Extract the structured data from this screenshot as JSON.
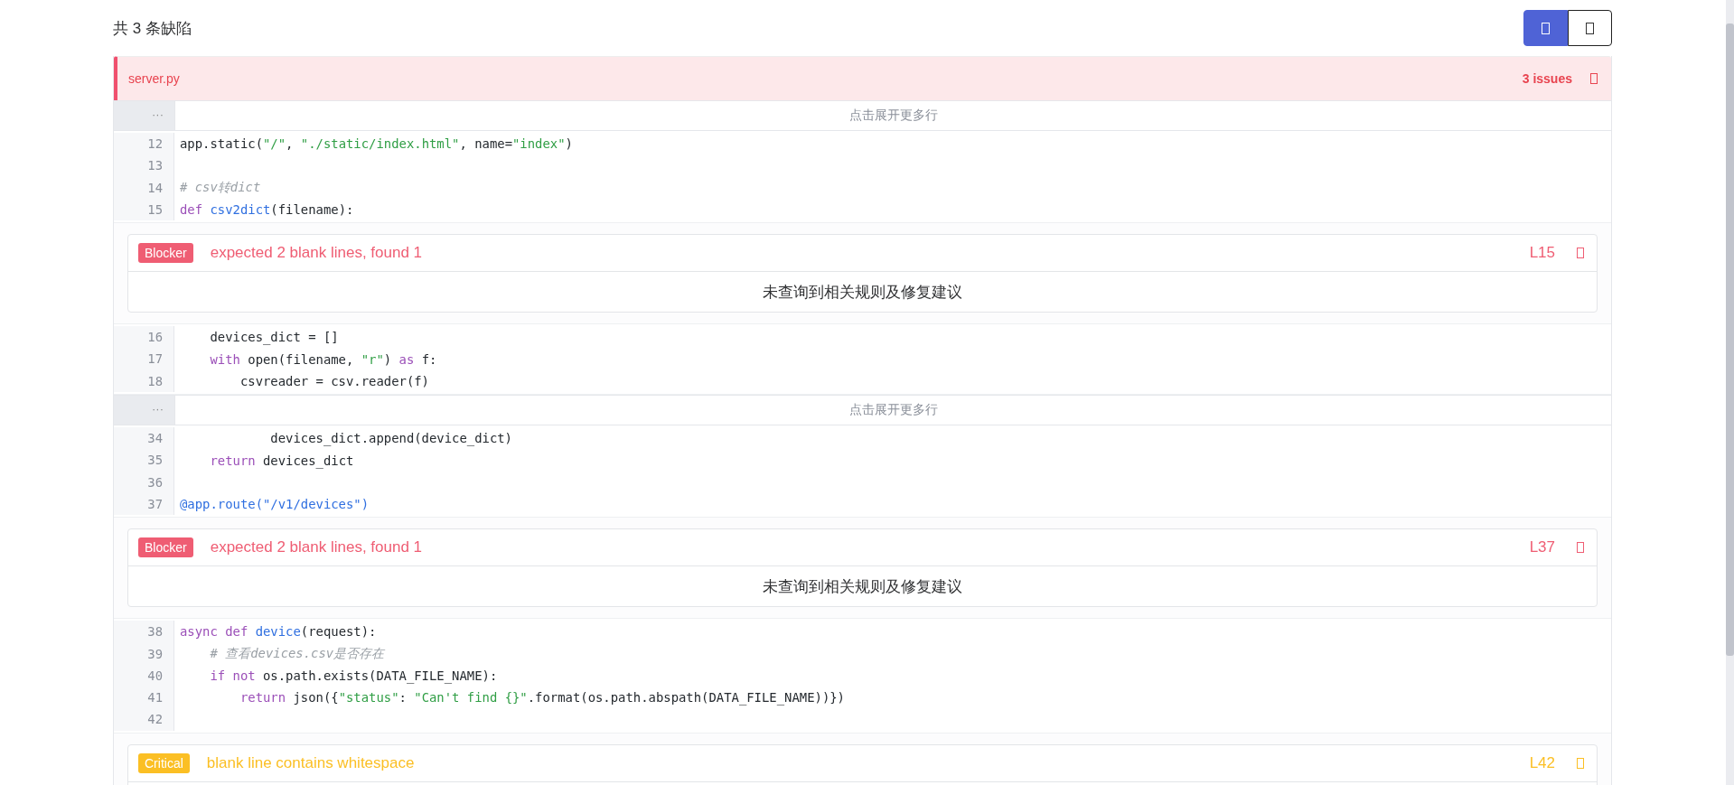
{
  "summary": "共 3 条缺陷",
  "view_toggle": [
    {
      "selected": true
    },
    {
      "selected": false
    }
  ],
  "file": {
    "name": "server.py",
    "issues_label": "3 issues",
    "blocks": [
      {
        "kind": "fold",
        "gutter": "···",
        "label": "点击展开更多行"
      },
      {
        "kind": "code",
        "lines": [
          {
            "no": "12",
            "tokens": [
              {
                "kind": "plain",
                "s": "app.static("
              },
              {
                "kind": "str",
                "s": "\"/\""
              },
              {
                "kind": "plain",
                "s": ", "
              },
              {
                "kind": "str",
                "s": "\"./static/index.html\""
              },
              {
                "kind": "plain",
                "s": ", name="
              },
              {
                "kind": "str",
                "s": "\"index\""
              },
              {
                "kind": "plain",
                "s": ")"
              }
            ]
          },
          {
            "no": "13"
          },
          {
            "no": "14",
            "tokens": [
              {
                "kind": "cmt",
                "s": "# csv转dict"
              }
            ]
          },
          {
            "no": "15",
            "tokens": [
              {
                "kind": "kw",
                "s": "def "
              },
              {
                "kind": "fn",
                "s": "csv2dict"
              },
              {
                "kind": "plain",
                "s": "(filename):"
              }
            ]
          }
        ]
      },
      {
        "kind": "issue",
        "severity": "Blocker",
        "color": "#ef5d73",
        "message": "expected 2 blank lines, found 1",
        "line": "L15",
        "suggestion": "未查询到相关规则及修复建议"
      },
      {
        "kind": "code",
        "lines": [
          {
            "no": "16",
            "tokens": [
              {
                "kind": "plain",
                "s": "    devices_dict = []"
              }
            ]
          },
          {
            "no": "17",
            "tokens": [
              {
                "kind": "kw",
                "s": "    with"
              },
              {
                "kind": "plain",
                "s": " open(filename, "
              },
              {
                "kind": "str",
                "s": "\"r\""
              },
              {
                "kind": "plain",
                "s": ") "
              },
              {
                "kind": "kw",
                "s": "as"
              },
              {
                "kind": "plain",
                "s": " f:"
              }
            ]
          },
          {
            "no": "18",
            "tokens": [
              {
                "kind": "plain",
                "s": "        csvreader = csv.reader(f)"
              }
            ]
          }
        ]
      },
      {
        "kind": "fold",
        "gutter": "···",
        "label": "点击展开更多行"
      },
      {
        "kind": "code",
        "lines": [
          {
            "no": "34",
            "tokens": [
              {
                "kind": "plain",
                "s": "            devices_dict.append(device_dict)"
              }
            ]
          },
          {
            "no": "35",
            "tokens": [
              {
                "kind": "kw",
                "s": "    return"
              },
              {
                "kind": "plain",
                "s": " devices_dict"
              }
            ]
          },
          {
            "no": "36"
          },
          {
            "no": "37",
            "tokens": [
              {
                "kind": "fn",
                "s": "@app.route(\"/v1/devices\")"
              }
            ]
          }
        ]
      },
      {
        "kind": "issue",
        "severity": "Blocker",
        "color": "#ef5d73",
        "message": "expected 2 blank lines, found 1",
        "line": "L37",
        "suggestion": "未查询到相关规则及修复建议"
      },
      {
        "kind": "code",
        "lines": [
          {
            "no": "38",
            "tokens": [
              {
                "kind": "kw",
                "s": "async def "
              },
              {
                "kind": "fn",
                "s": "device"
              },
              {
                "kind": "plain",
                "s": "(request):"
              }
            ]
          },
          {
            "no": "39",
            "tokens": [
              {
                "kind": "cmt",
                "s": "    # 查看devices.csv是否存在"
              }
            ]
          },
          {
            "no": "40",
            "tokens": [
              {
                "kind": "kw",
                "s": "    if not"
              },
              {
                "kind": "plain",
                "s": " os.path.exists(DATA_FILE_NAME):"
              }
            ]
          },
          {
            "no": "41",
            "tokens": [
              {
                "kind": "kw",
                "s": "        return"
              },
              {
                "kind": "plain",
                "s": " json({"
              },
              {
                "kind": "str",
                "s": "\"status\""
              },
              {
                "kind": "plain",
                "s": ": "
              },
              {
                "kind": "str",
                "s": "\"Can't find {}\""
              },
              {
                "kind": "plain",
                "s": ".format(os.path.abspath(DATA_FILE_NAME))})"
              }
            ]
          },
          {
            "no": "42"
          }
        ]
      },
      {
        "kind": "issue",
        "severity": "Critical",
        "color": "#fbbf24",
        "message": "blank line contains whitespace",
        "line": "L42"
      }
    ]
  }
}
